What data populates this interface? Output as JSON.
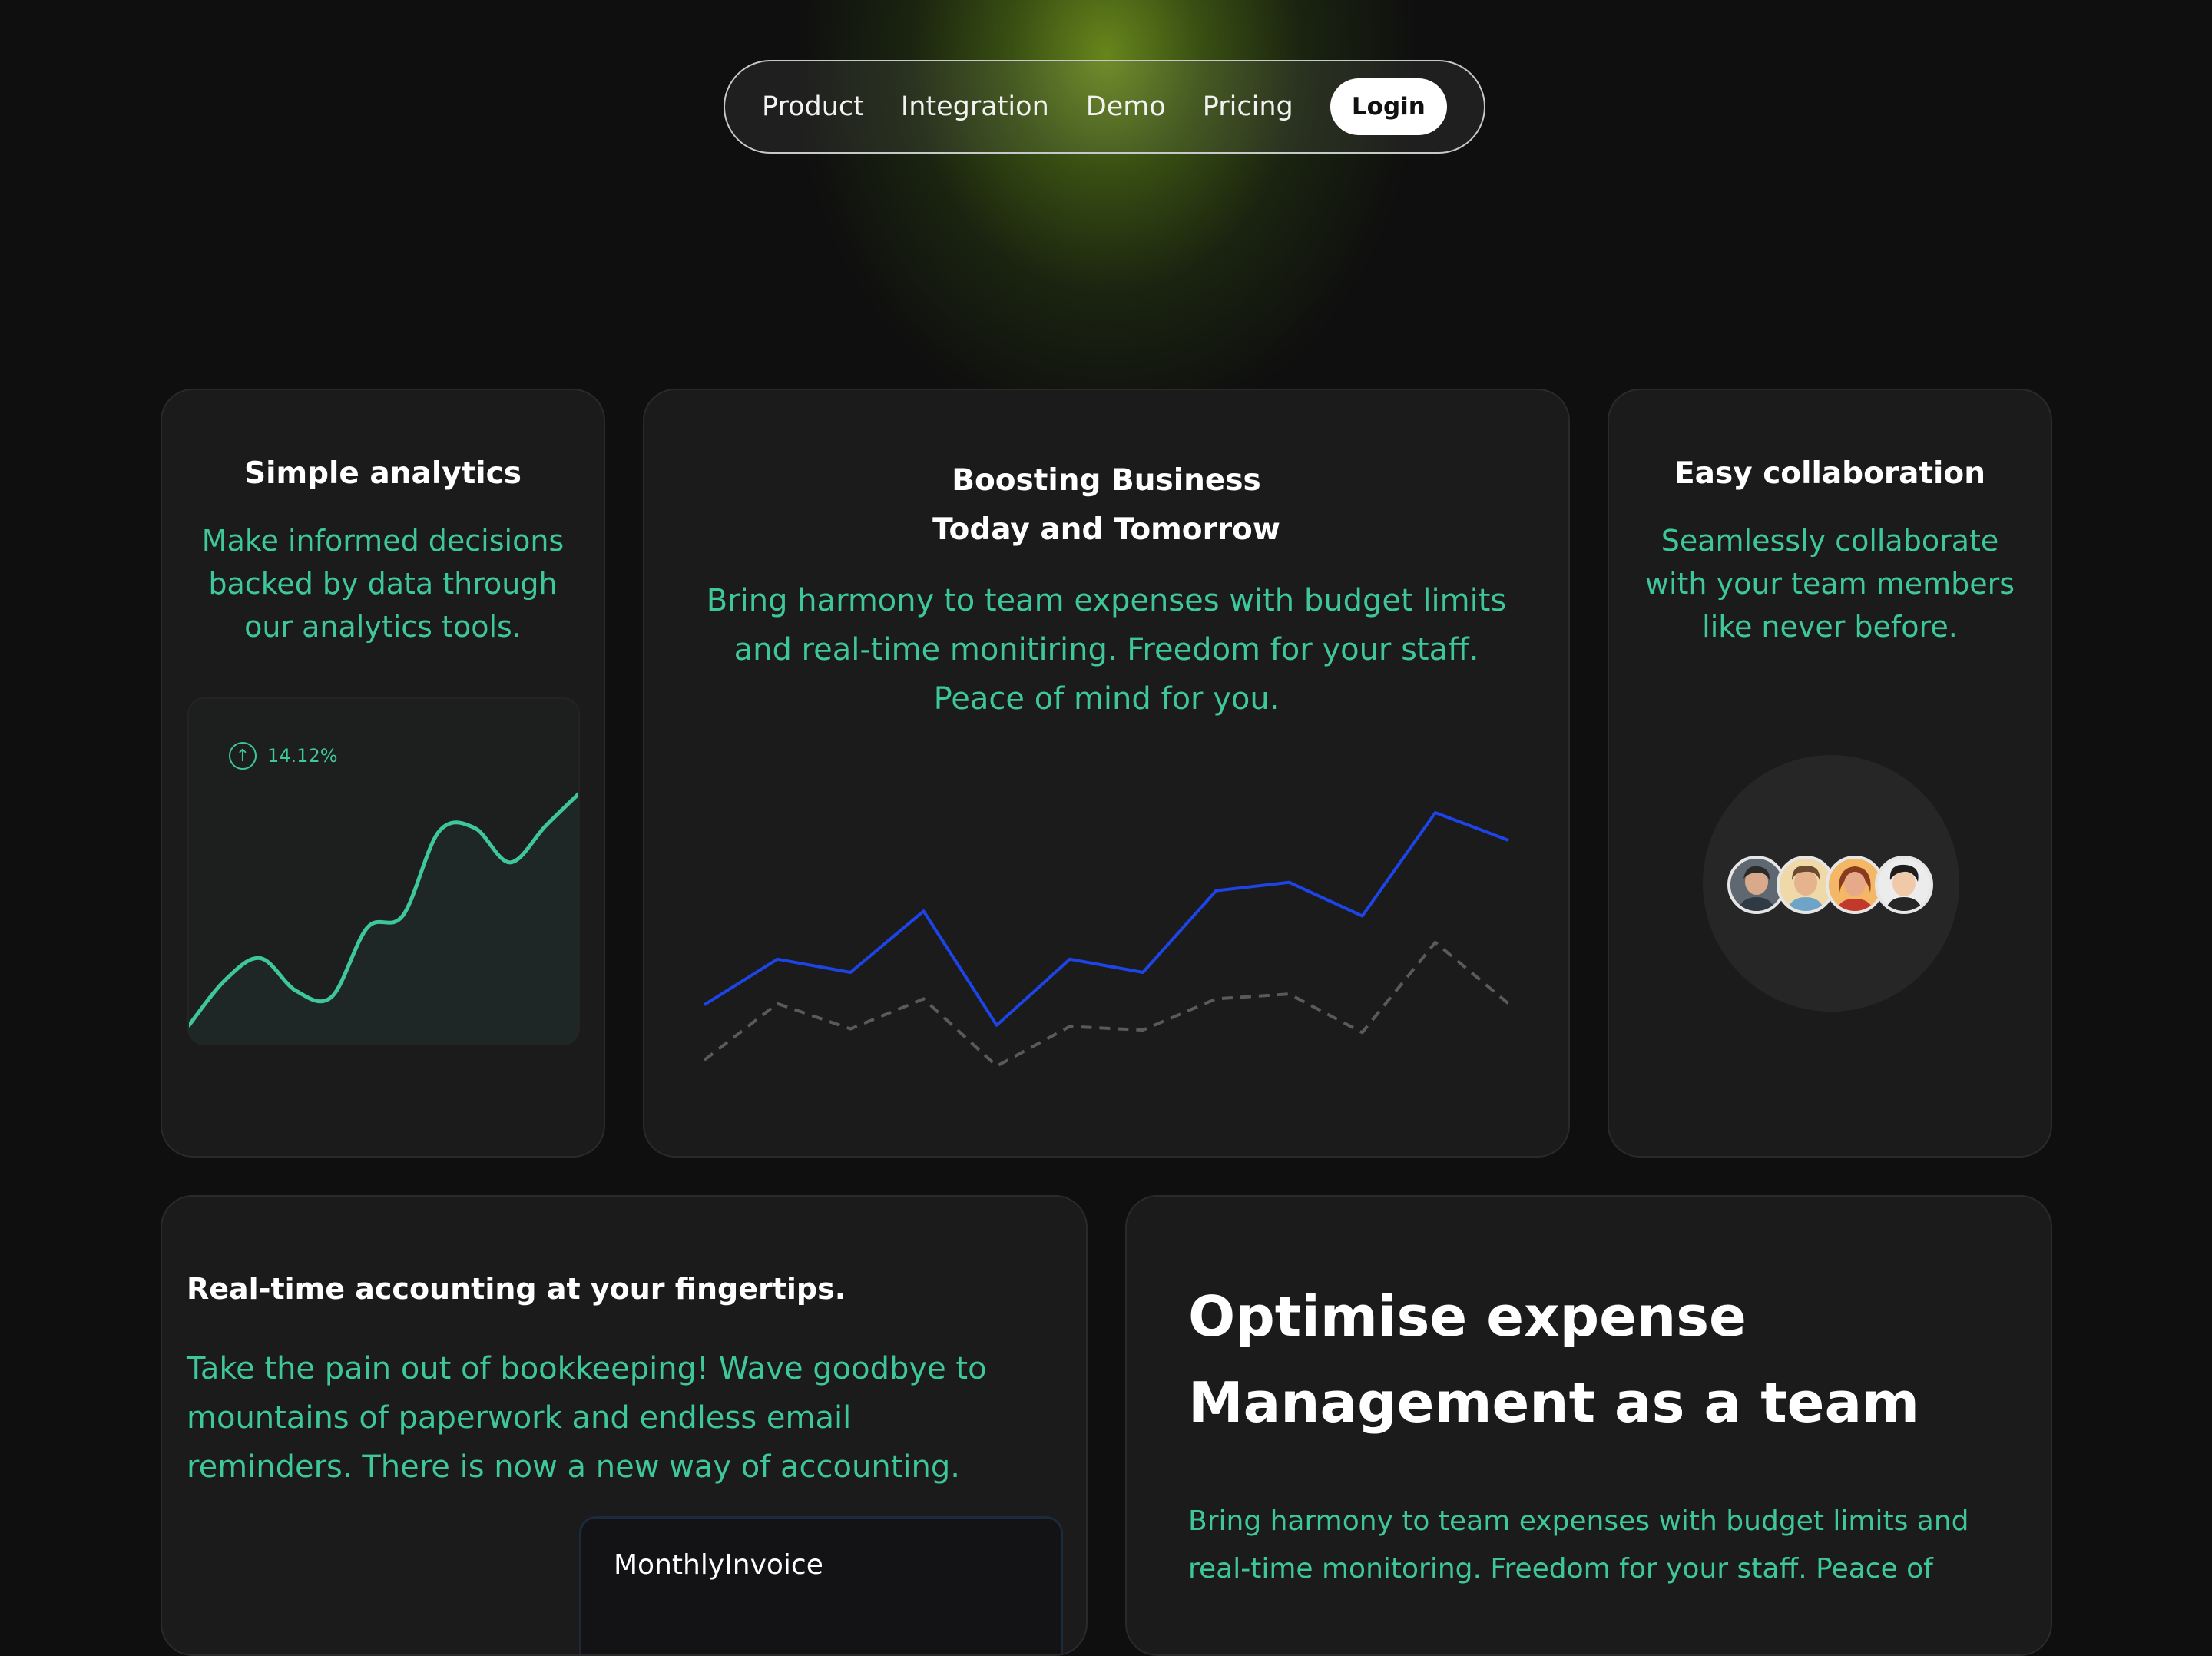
{
  "colors": {
    "accent": "#3fc79c",
    "background": "#0f0f0f",
    "card": "#1b1b1b",
    "chart_primary": "#1d44e6",
    "chart_secondary": "#5a5a5a",
    "glow": "#6c8c1c"
  },
  "nav": {
    "items": [
      "Product",
      "Integration",
      "Demo",
      "Pricing"
    ],
    "login_label": "Login"
  },
  "cards": {
    "analytics": {
      "title": "Simple analytics",
      "description": "Make informed decisions backed by data through our analytics tools.",
      "badge_value": "14.12%",
      "badge_icon": "arrow-up-icon"
    },
    "boosting": {
      "title_line1": "Boosting Business",
      "title_line2": "Today and Tomorrow",
      "description": "Bring harmony to team expenses with budget limits and real-time monitiring. Freedom for your staff. Peace of mind for you."
    },
    "collaboration": {
      "title": "Easy collaboration",
      "description": "Seamlessly collaborate with your team members like never before.",
      "avatars": [
        "avatar-1",
        "avatar-2",
        "avatar-3",
        "avatar-4"
      ]
    },
    "accounting": {
      "title": "Real-time accounting at your fingertips.",
      "description": "Take the pain out of bookkeeping! Wave goodbye to mountains of paperwork and endless email reminders. There is now a new way of accounting.",
      "invoice_title": "MonthlyInvoice"
    },
    "optimise": {
      "title_line1": "Optimise expense",
      "title_line2": "Management as a team",
      "description": "Bring harmony to team expenses with budget limits and real-time monitoring. Freedom for your staff. Peace of"
    }
  },
  "chart_data": [
    {
      "type": "line",
      "series": [
        {
          "values": [
            0,
            22,
            33,
            17,
            14,
            48,
            54,
            95,
            97,
            80,
            98,
            115
          ]
        }
      ],
      "grid": false
    },
    {
      "type": "line",
      "series": [
        {
          "values": [
            86,
            124,
            113,
            164,
            69,
            124,
            113,
            181,
            188,
            160,
            246,
            223
          ]
        },
        {
          "values": [
            40,
            87,
            66,
            91,
            35,
            68,
            65,
            91,
            95,
            63,
            138,
            87
          ],
          "style": "dashed"
        }
      ],
      "grid": false
    }
  ]
}
